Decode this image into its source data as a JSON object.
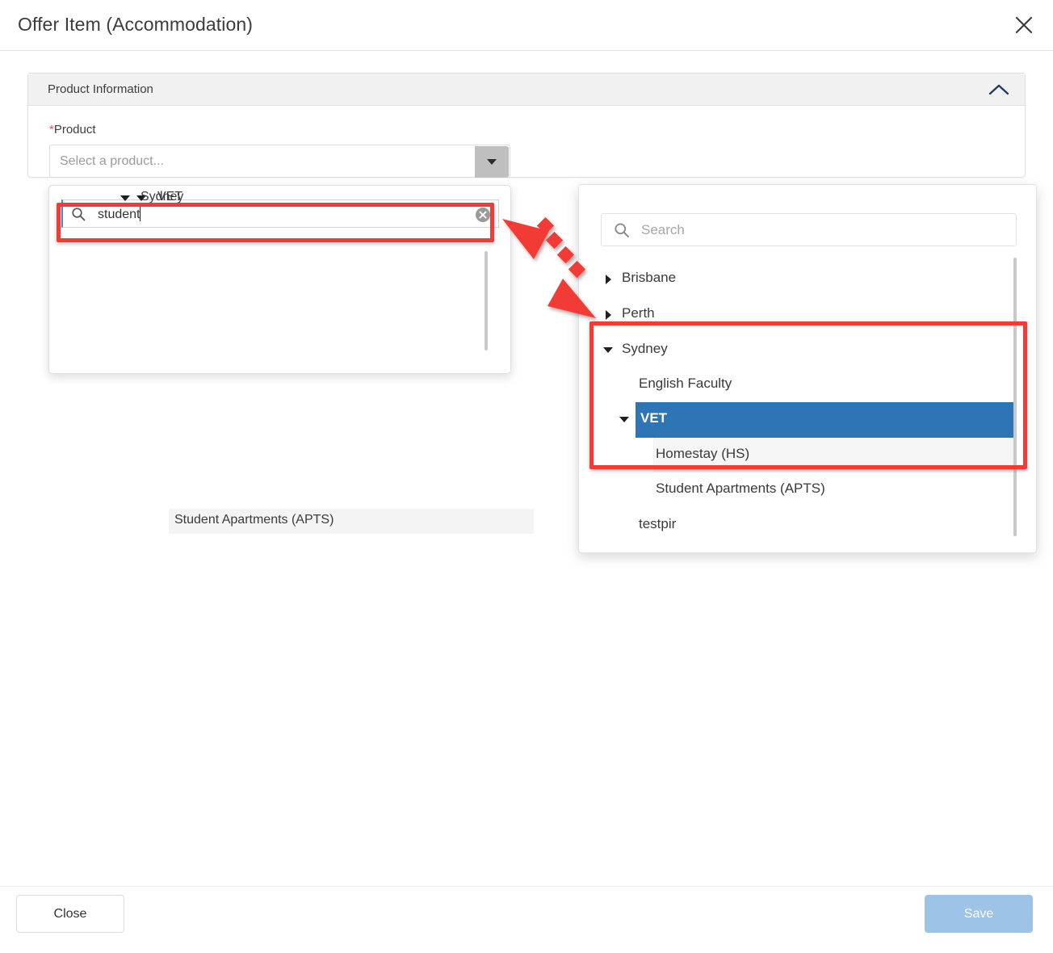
{
  "modal": {
    "title": "Offer Item (Accommodation)",
    "close_icon": "close-icon"
  },
  "card": {
    "header_title": "Product Information",
    "collapse_icon": "chevron-up-icon"
  },
  "form": {
    "product_label": "Product",
    "required_marker": "*",
    "product_placeholder": "Select a product...",
    "dropdown_toggle_icon": "chevron-down-icon"
  },
  "left_dropdown": {
    "search_icon": "search-icon",
    "search_value": "student",
    "clear_icon": "clear-circle-icon",
    "tree": [
      {
        "label": "Sydney",
        "depth": 0,
        "expander": "caret-down",
        "selected": false,
        "hover": false
      },
      {
        "label": "VET",
        "depth": 1,
        "expander": "caret-down",
        "selected": false,
        "hover": false
      },
      {
        "label": "Student Apartments (APTS)",
        "depth": 2,
        "expander": "none",
        "selected": false,
        "hover": true
      }
    ]
  },
  "right_dropdown": {
    "search_icon": "search-icon",
    "search_placeholder": "Search",
    "search_value": "",
    "tree": [
      {
        "label": "Brisbane",
        "depth": 0,
        "expander": "caret-right",
        "selected": false,
        "hover": false
      },
      {
        "label": "Perth",
        "depth": 0,
        "expander": "caret-right",
        "selected": false,
        "hover": false
      },
      {
        "label": "Sydney",
        "depth": 0,
        "expander": "caret-down",
        "selected": false,
        "hover": false
      },
      {
        "label": "English Faculty",
        "depth": 1,
        "expander": "none",
        "selected": false,
        "hover": false
      },
      {
        "label": "VET",
        "depth": 1,
        "expander": "caret-down",
        "selected": true,
        "hover": false
      },
      {
        "label": "Homestay (HS)",
        "depth": 2,
        "expander": "none",
        "selected": false,
        "hover": true
      },
      {
        "label": "Student Apartments (APTS)",
        "depth": 2,
        "expander": "none",
        "selected": false,
        "hover": false
      },
      {
        "label": "testpir",
        "depth": 1,
        "expander": "none",
        "selected": false,
        "hover": false
      }
    ]
  },
  "footer": {
    "close_label": "Close",
    "save_label": "Save"
  },
  "annotations": {
    "arrow_icon": "double-headed-dashed-arrow",
    "highlight_color": "#f23b34",
    "selection_color": "#2e75b6"
  }
}
